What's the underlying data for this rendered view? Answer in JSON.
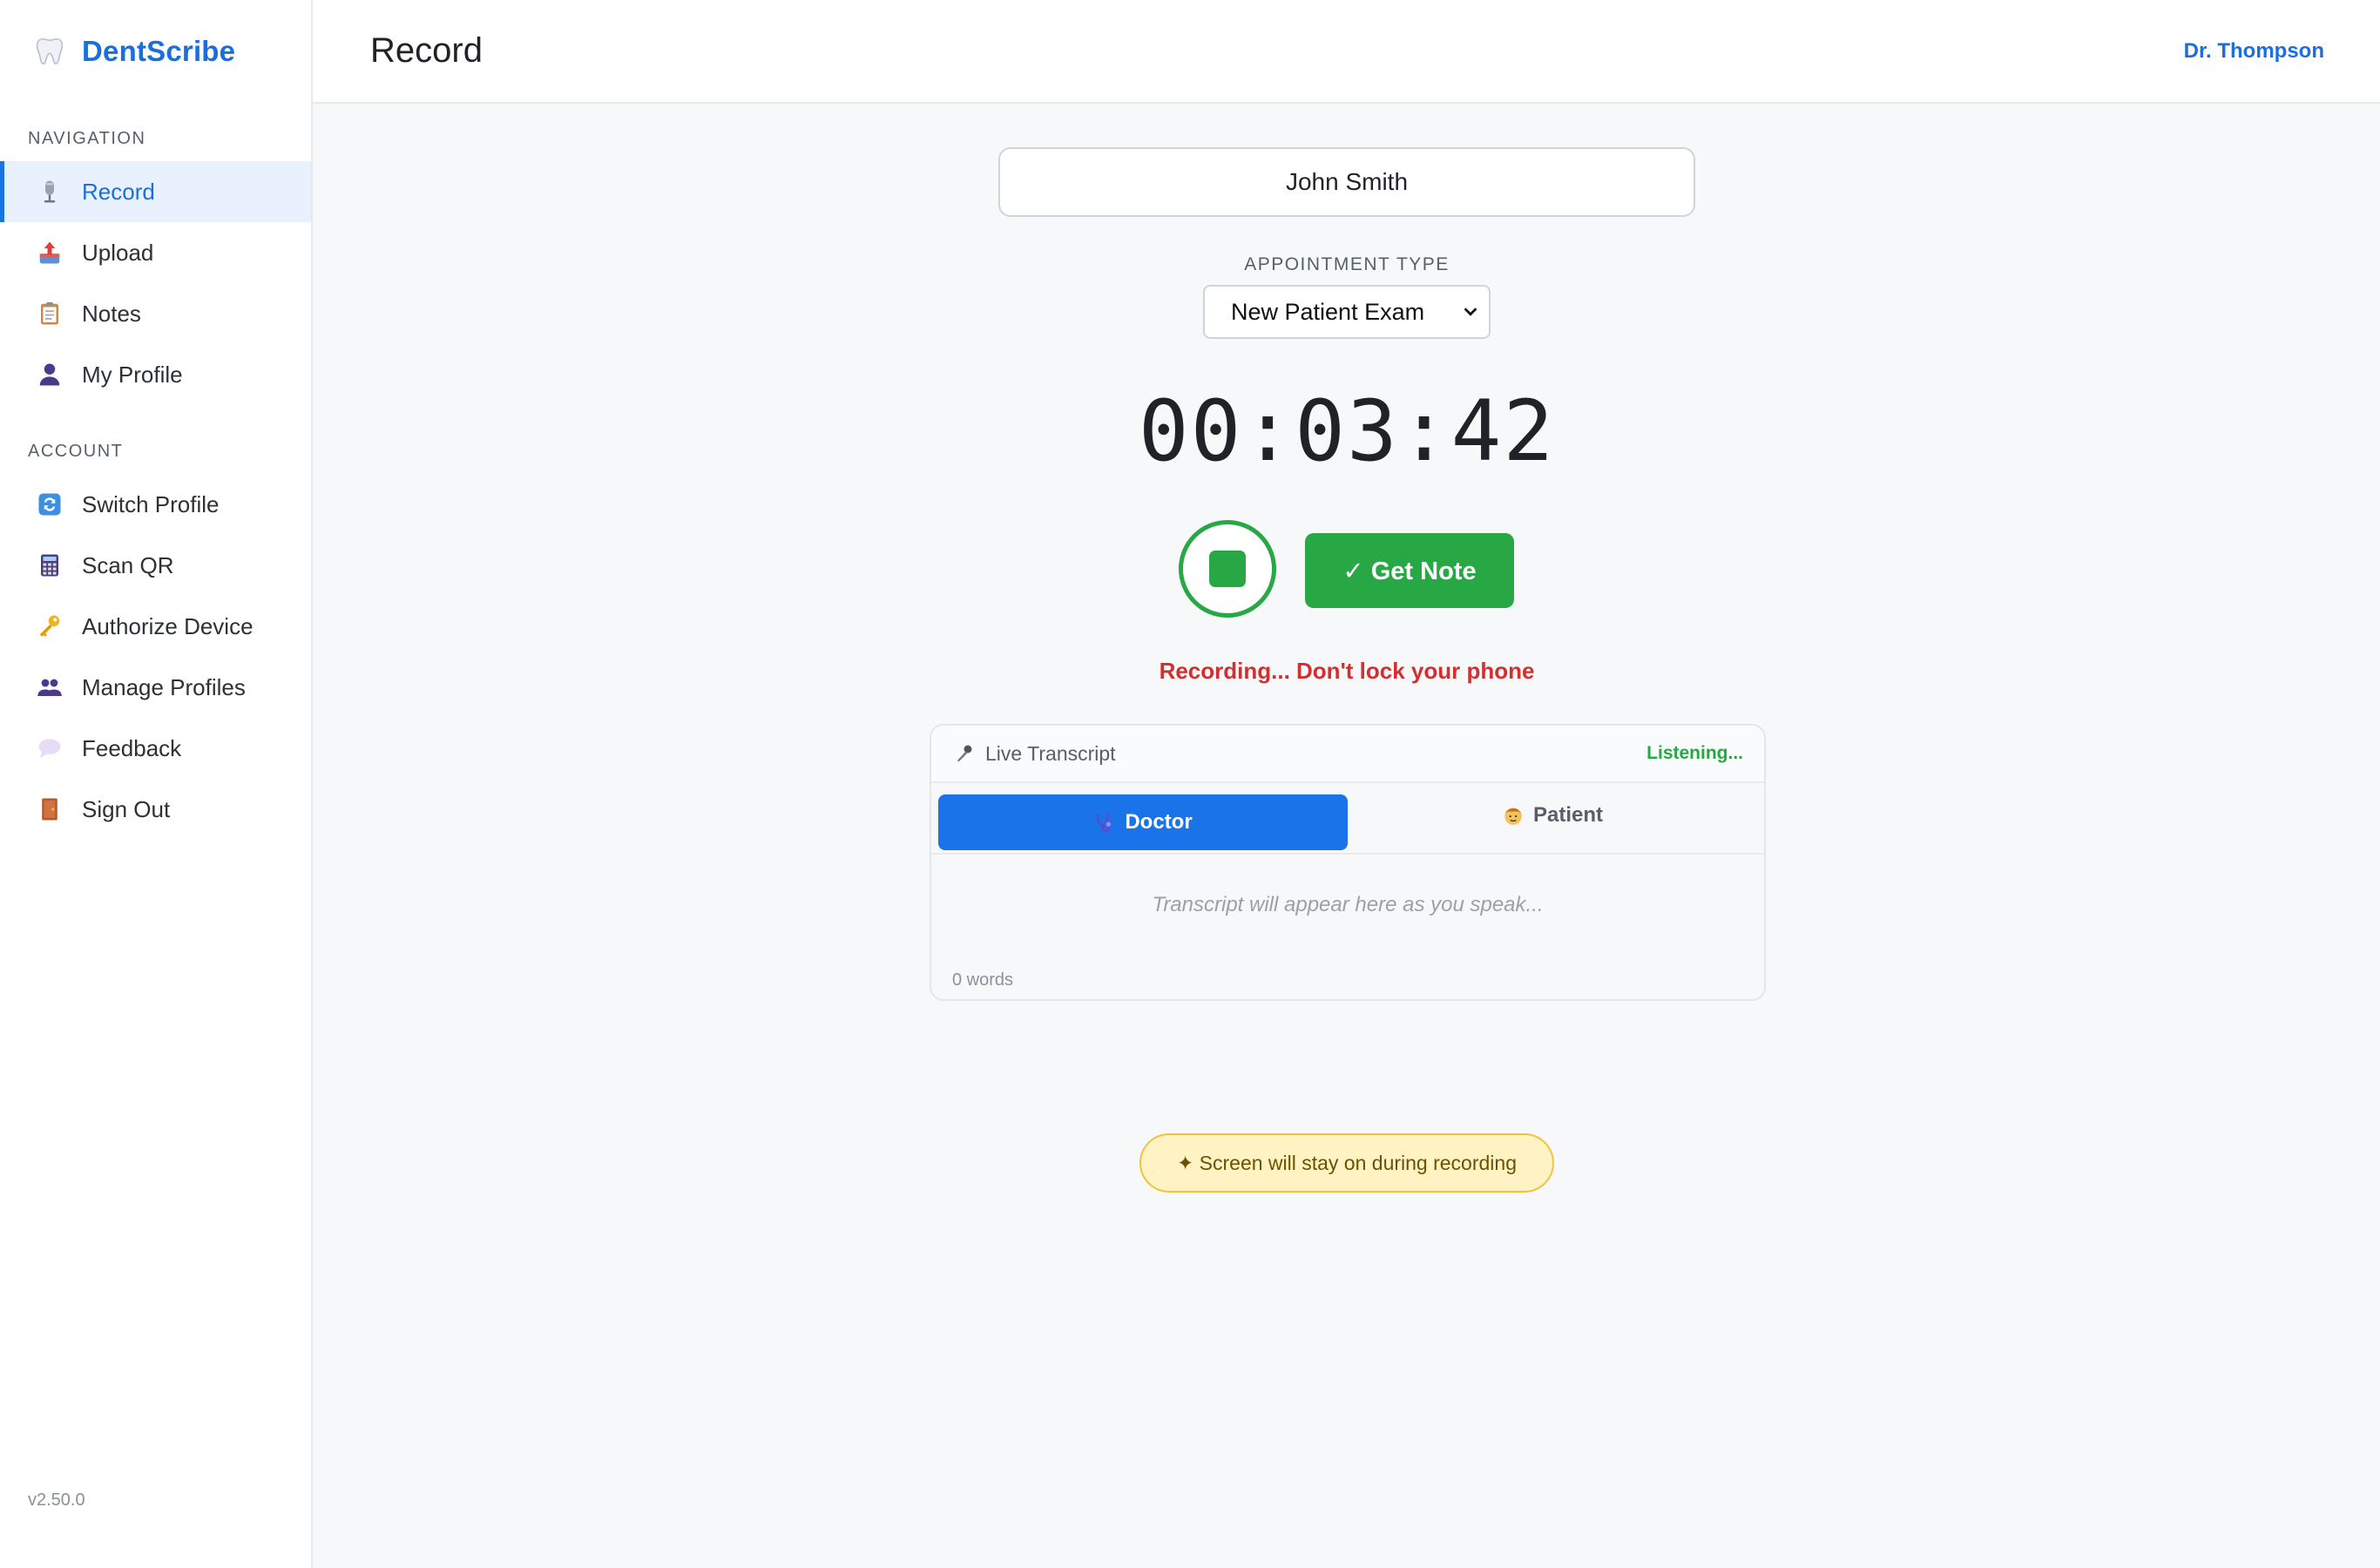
{
  "brand": {
    "name": "DentScribe"
  },
  "sidebar": {
    "navigation_label": "NAVIGATION",
    "nav_items": [
      {
        "label": "Record",
        "icon": "microphone-icon",
        "active": true
      },
      {
        "label": "Upload",
        "icon": "upload-icon"
      },
      {
        "label": "Notes",
        "icon": "clipboard-icon"
      },
      {
        "label": "My Profile",
        "icon": "person-icon"
      }
    ],
    "account_label": "ACCOUNT",
    "account_items": [
      {
        "label": "Switch Profile",
        "icon": "switch-icon"
      },
      {
        "label": "Scan QR",
        "icon": "calculator-icon"
      },
      {
        "label": "Authorize Device",
        "icon": "key-icon"
      },
      {
        "label": "Manage Profiles",
        "icon": "people-icon"
      },
      {
        "label": "Feedback",
        "icon": "speech-bubble-icon"
      },
      {
        "label": "Sign Out",
        "icon": "door-icon"
      }
    ],
    "version": "v2.50.0"
  },
  "header": {
    "title": "Record",
    "user": "Dr. Thompson"
  },
  "record": {
    "patient_name": "John Smith",
    "appointment_label": "APPOINTMENT TYPE",
    "appointment_value": "New Patient Exam",
    "timer": "00:03:42",
    "get_note_label": "✓ Get Note",
    "status": "Recording... Don't lock your phone"
  },
  "transcript": {
    "title": "Live Transcript",
    "state": "Listening...",
    "speakers": [
      {
        "label": "Doctor",
        "active": true
      },
      {
        "label": "Patient",
        "active": false
      }
    ],
    "placeholder": "Transcript will appear here as you speak...",
    "word_count": "0 words"
  },
  "wake_notice": "✦ Screen will stay on during recording",
  "colors": {
    "accent": "#1a73e8",
    "record_green": "#28a745",
    "status_red": "#d32f2f",
    "notice_bg": "#fff3c4"
  }
}
